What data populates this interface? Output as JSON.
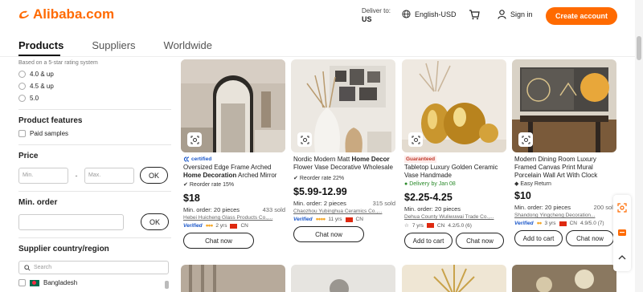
{
  "header": {
    "logo_text": "Alibaba.com",
    "deliver_label": "Deliver to:",
    "deliver_country": "US",
    "language": "English-USD",
    "sign_in": "Sign in",
    "create_account": "Create account",
    "brand_color": "#ff6a00"
  },
  "tabs": [
    "Products",
    "Suppliers",
    "Worldwide"
  ],
  "sidebar": {
    "rating_note": "Based on a 5-star rating system",
    "ratings": [
      "4.0 & up",
      "4.5 & up",
      "5.0"
    ],
    "features_title": "Product features",
    "features": [
      "Paid samples"
    ],
    "price_title": "Price",
    "price_min_placeholder": "Min.",
    "price_max_placeholder": "Max.",
    "price_sep": "-",
    "ok": "OK",
    "min_order_title": "Min. order",
    "supplier_title": "Supplier country/region",
    "search_placeholder": "Search",
    "countries": [
      "Bangladesh"
    ]
  },
  "products": [
    {
      "badge": "certified",
      "title_pre": "Oversized Edge Frame Arched ",
      "title_bold": "Home Decoration",
      "title_post": " Arched Mirror",
      "tag": "Reorder rate 15%",
      "price": "$18",
      "moq": "Min. order: 20 pieces",
      "sold": "433 sold",
      "supplier": "Hebei Huicheng Glass Products Co.,...",
      "verified": "Verified",
      "years": "2 yrs",
      "country": "CN",
      "rating": "",
      "chat": "Chat now",
      "cart": ""
    },
    {
      "badge": "",
      "title_pre": "Nordic Modern Matt ",
      "title_bold": "Home Decor",
      "title_post": " Flower Vase Decorative Wholesale Ceramic Vases",
      "tag": "Reorder rate 22%",
      "price": "$5.99-12.99",
      "moq": "Min. order: 2 pieces",
      "sold": "315 sold",
      "supplier": "Chaozhou Yubinghua Ceramics Co.,...",
      "verified": "Verified",
      "years": "11 yrs",
      "country": "CN",
      "rating": "",
      "chat": "Chat now",
      "cart": ""
    },
    {
      "badge": "Guaranteed",
      "title_pre": "Tabletop Luxury Golden Ceramic Vase Handmade",
      "title_bold": "",
      "title_post": "",
      "tag": "Delivery by Jan 08",
      "price": "$2.25-4.25",
      "moq": "Min. order: 20 pieces",
      "sold": "",
      "supplier": "Dehua County Wuliwuwai Trade Co.,...",
      "verified": "",
      "years": "7 yrs",
      "country": "CN",
      "rating": "4.2/5.0 (6)",
      "chat": "Chat now",
      "cart": "Add to cart"
    },
    {
      "badge": "",
      "title_pre": "Modern Dining Room Luxury Framed Canvas Print Mural Porcelain Wall Art With Clock",
      "title_bold": "",
      "title_post": "",
      "tag": "Easy Return",
      "price": "$10",
      "moq": "Min. order: 20 pieces",
      "sold": "200 sold",
      "supplier": "Shandong Yingcheng Decoration...",
      "verified": "Verified",
      "years": "3 yrs",
      "country": "CN",
      "rating": "4.9/5.0 (7)",
      "chat": "Chat now",
      "cart": "Add to cart"
    }
  ],
  "float_icons": [
    "scan-icon",
    "rfq-icon",
    "chevron-up-icon"
  ]
}
